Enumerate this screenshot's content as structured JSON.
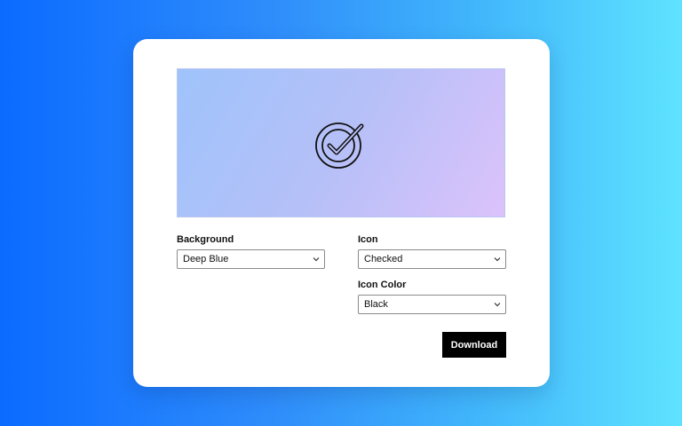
{
  "preview": {
    "icon": "checked-circle-icon",
    "icon_color": "#000000",
    "background_colors": [
      "#9fc3fb",
      "#b6c0f8",
      "#dcc2fb"
    ]
  },
  "fields": {
    "background": {
      "label": "Background",
      "value": "Deep Blue"
    },
    "icon": {
      "label": "Icon",
      "value": "Checked"
    },
    "icon_color": {
      "label": "Icon Color",
      "value": "Black"
    }
  },
  "actions": {
    "download_label": "Download"
  },
  "colors": {
    "page_gradient_start": "#0b6bff",
    "page_gradient_end": "#5ee3ff",
    "card": "#ffffff",
    "button": "#000000"
  }
}
